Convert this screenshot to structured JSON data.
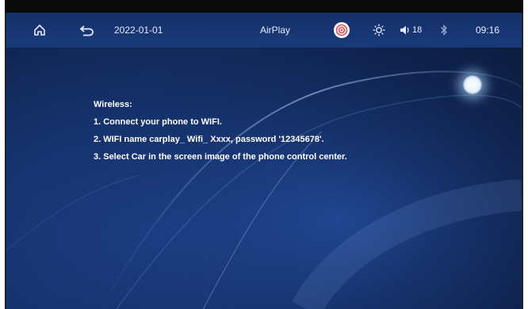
{
  "status_bar": {
    "date": "2022-01-01",
    "mode": "AirPlay",
    "volume": "18",
    "time": "09:16",
    "icons": [
      "home-icon",
      "back-icon",
      "airplay-signal-icon",
      "brightness-icon",
      "volume-icon",
      "bluetooth-icon"
    ]
  },
  "instructions": {
    "heading": "Wireless:",
    "steps": [
      "1. Connect your phone to WIFI.",
      "2. WIFI name carplay_ Wifi_ Xxxx, password '12345678'.",
      "3. Select Car in the screen image of the phone control center."
    ]
  },
  "colors": {
    "background": "#173470",
    "status_bar": "#183a7a",
    "text": "#ffffff"
  }
}
